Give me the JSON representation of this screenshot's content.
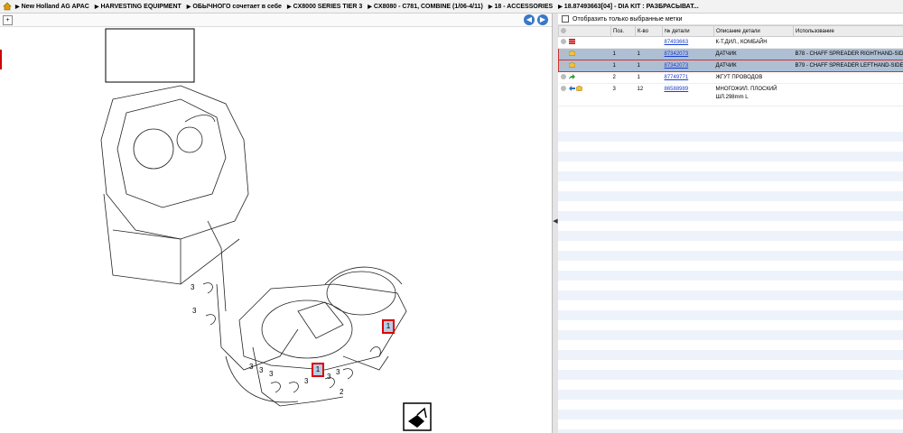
{
  "breadcrumb": [
    "New Holland AG APAC",
    "HARVESTING EQUIPMENT",
    "ОБЫЧНОГО сочетает в себе",
    "CX8000 SERIES TIER 3",
    "CX8080 - C781, COMBINE (1/06-4/11)",
    "18 - ACCESSORIES",
    "18.87493663[04] - DIA KIT : РАЗБРАСЫВАТ..."
  ],
  "toolbar": {
    "zoom_label": "+",
    "prev": "◀",
    "next": "▶"
  },
  "filter": {
    "label": "Отобразить только выбранные метки"
  },
  "table": {
    "headers": {
      "pos": "Поз.",
      "qty": "К-во",
      "part": "№ детали",
      "desc": "Описание детали",
      "usage": "Использование"
    },
    "rows": [
      {
        "pos": "",
        "qty": "",
        "part": "87493663",
        "desc": "К-Т.ДИЛ., КОМБАЙН",
        "usage": "",
        "selected": false,
        "icon": "red-stack-icon"
      },
      {
        "pos": "1",
        "qty": "1",
        "part": "87342073",
        "desc": "ДАТЧИК",
        "usage": "B78 - CHAFF SPREADER RIGHTHAND-SIDE",
        "selected": true,
        "icon": "yellow-box-icon"
      },
      {
        "pos": "1",
        "qty": "1",
        "part": "87342073",
        "desc": "ДАТЧИК",
        "usage": "B79 - CHAFF SPREADER LEFTHAND-SIDE",
        "selected": true,
        "icon": "yellow-box-icon"
      },
      {
        "pos": "2",
        "qty": "1",
        "part": "87749771",
        "desc": "ЖГУТ ПРОВОДОВ",
        "usage": "",
        "selected": false,
        "icon": "green-arrow-icon"
      },
      {
        "pos": "3",
        "qty": "12",
        "part": "86588989",
        "desc": "МНОГОЖИЛ. ПЛОСКИЙ ШЛ.298mm L",
        "usage": "",
        "selected": false,
        "icon": "blue-yellow-icon"
      }
    ]
  },
  "diagram": {
    "callout_3": "3",
    "callout_2": "2",
    "callout_1": "1"
  }
}
